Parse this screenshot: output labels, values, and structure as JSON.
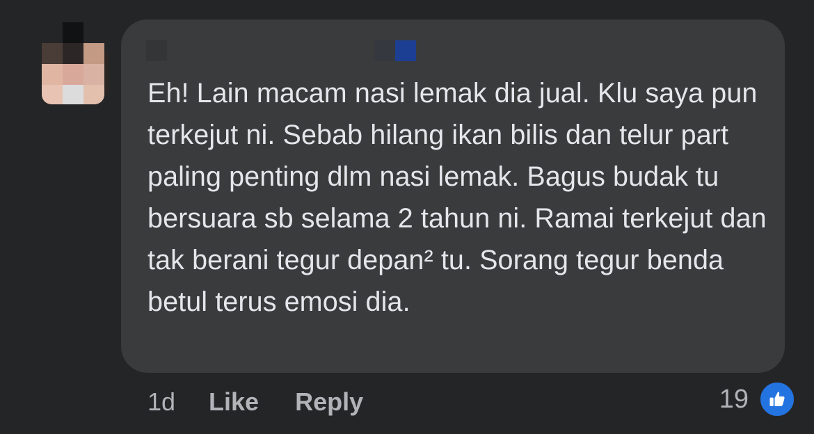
{
  "comment": {
    "text": "Eh! Lain macam nasi lemak dia jual. Klu saya pun terkejut ni. Sebab hilang ikan bilis dan telur part paling penting dlm nasi lemak. Bagus budak tu bersuara sb selama 2 tahun ni. Ramai terkejut dan tak berani tegur depan² tu. Sorang tegur benda betul terus emosi dia."
  },
  "actions": {
    "timestamp": "1d",
    "like_label": "Like",
    "reply_label": "Reply"
  },
  "reactions": {
    "count": "19",
    "icon": "thumbs-up-icon",
    "color": "#2374e1"
  },
  "colors": {
    "background": "#242526",
    "bubble": "#3a3b3c",
    "text": "#e4e6eb",
    "secondary_text": "#b0b3b8"
  }
}
